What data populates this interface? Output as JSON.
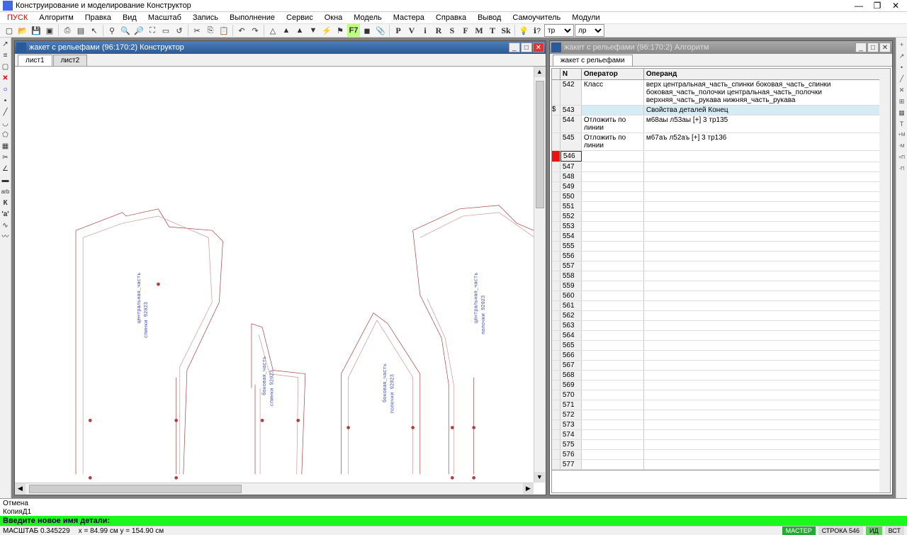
{
  "title": "Конструирование и моделирование  Конструктор",
  "menu": [
    "ПУСК",
    "Алгоритм",
    "Правка",
    "Вид",
    "Масштаб",
    "Запись",
    "Выполнение",
    "Сервис",
    "Окна",
    "Модель",
    "Мастера",
    "Справка",
    "Вывод",
    "Самоучитель",
    "Модули"
  ],
  "toolbar_text": [
    "P",
    "V",
    "i",
    "R",
    "S",
    "F",
    "M",
    "T",
    "Sk"
  ],
  "toolbar_hot": "F7",
  "combo1": "тр",
  "combo2": "лр",
  "left_window": {
    "title": "жакет с рельефами (96:170:2) Конструктор",
    "tabs": [
      "лист1",
      "лист2"
    ]
  },
  "right_window": {
    "title": "жакет с рельефами (96:170:2) Алгоритм",
    "tab": "жакет с рельефами",
    "headers": {
      "n": "N",
      "op": "Оператор",
      "operand": "Операнд"
    },
    "rows": [
      {
        "n": "542",
        "op": "Класс",
        "val": "верх центральная_часть_спинки боковая_часть_спинки боковая_часть_полочки центральная_часть_полочки верхняя_часть_рукава нижняя_часть_рукава",
        "mark": ""
      },
      {
        "n": "543",
        "op": "",
        "val": "Свойства деталей Конец",
        "mark": "$",
        "hl": true
      },
      {
        "n": "544",
        "op": "Отложить по линии",
        "val": "м68аы л53аы [+] 3 тр135",
        "mark": ""
      },
      {
        "n": "545",
        "op": "Отложить по линии",
        "val": "м67аъ л52аъ [+] 3 тр136",
        "mark": ""
      },
      {
        "n": "546",
        "op": "",
        "val": "",
        "mark": "",
        "sel": true
      },
      {
        "n": "547",
        "op": "",
        "val": ""
      },
      {
        "n": "548",
        "op": "",
        "val": ""
      },
      {
        "n": "549",
        "op": "",
        "val": ""
      },
      {
        "n": "550",
        "op": "",
        "val": ""
      },
      {
        "n": "551",
        "op": "",
        "val": ""
      },
      {
        "n": "552",
        "op": "",
        "val": ""
      },
      {
        "n": "553",
        "op": "",
        "val": ""
      },
      {
        "n": "554",
        "op": "",
        "val": ""
      },
      {
        "n": "555",
        "op": "",
        "val": ""
      },
      {
        "n": "556",
        "op": "",
        "val": ""
      },
      {
        "n": "557",
        "op": "",
        "val": ""
      },
      {
        "n": "558",
        "op": "",
        "val": ""
      },
      {
        "n": "559",
        "op": "",
        "val": ""
      },
      {
        "n": "560",
        "op": "",
        "val": ""
      },
      {
        "n": "561",
        "op": "",
        "val": ""
      },
      {
        "n": "562",
        "op": "",
        "val": ""
      },
      {
        "n": "563",
        "op": "",
        "val": ""
      },
      {
        "n": "564",
        "op": "",
        "val": ""
      },
      {
        "n": "565",
        "op": "",
        "val": ""
      },
      {
        "n": "566",
        "op": "",
        "val": ""
      },
      {
        "n": "567",
        "op": "",
        "val": ""
      },
      {
        "n": "568",
        "op": "",
        "val": ""
      },
      {
        "n": "569",
        "op": "",
        "val": ""
      },
      {
        "n": "570",
        "op": "",
        "val": ""
      },
      {
        "n": "571",
        "op": "",
        "val": ""
      },
      {
        "n": "572",
        "op": "",
        "val": ""
      },
      {
        "n": "573",
        "op": "",
        "val": ""
      },
      {
        "n": "574",
        "op": "",
        "val": ""
      },
      {
        "n": "575",
        "op": "",
        "val": ""
      },
      {
        "n": "576",
        "op": "",
        "val": ""
      },
      {
        "n": "577",
        "op": "",
        "val": ""
      }
    ]
  },
  "log": [
    "Отмена",
    "КопияД1"
  ],
  "prompt": "Введите новое имя детали:",
  "status": {
    "scale": "МАСШТАБ 0.345229",
    "coords": "x = 84.99 см    y = 154.90 см",
    "master": "МАСТЕР",
    "row": "СТРОКА 546",
    "id": "ИД",
    "vst": "ВСТ"
  }
}
